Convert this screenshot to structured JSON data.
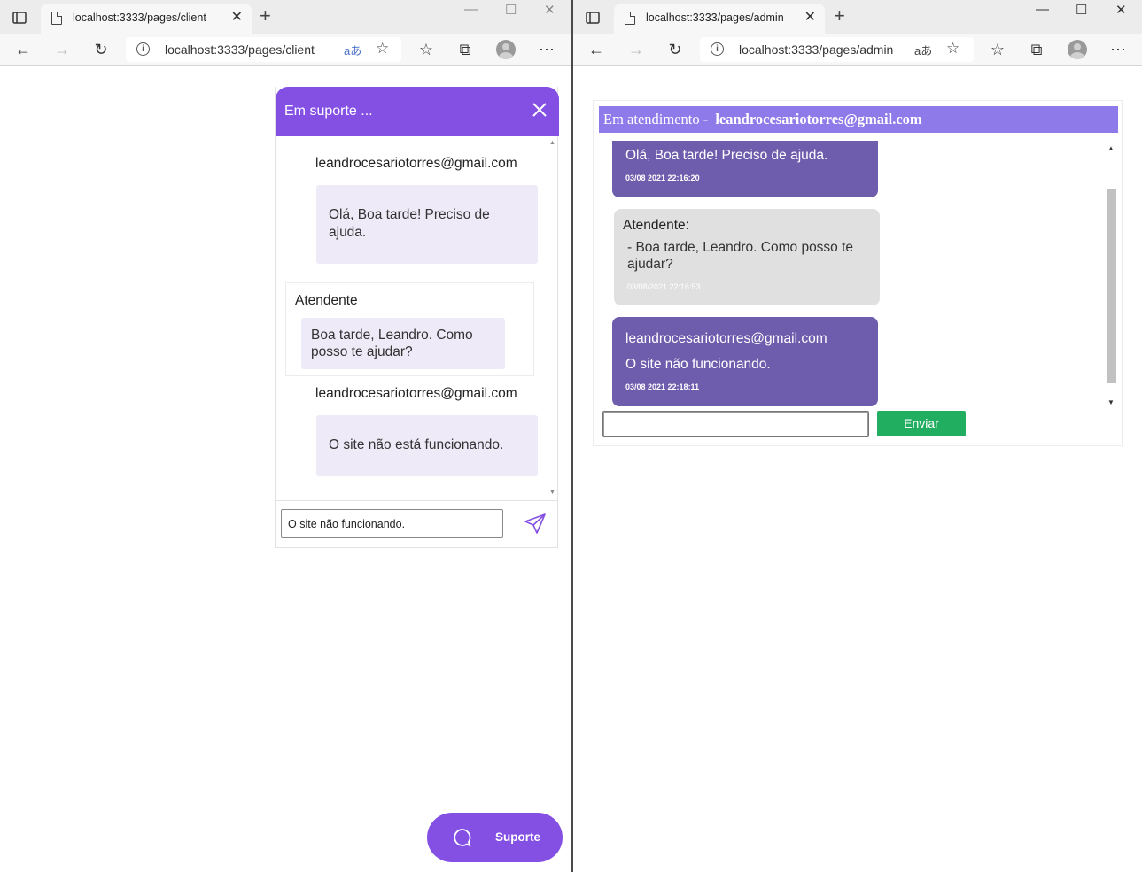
{
  "client_window": {
    "tab_title": "localhost:3333/pages/client",
    "url": "localhost:3333/pages/client",
    "chat": {
      "header_title": "Em suporte ...",
      "messages": [
        {
          "sender": "leandrocesariotorres@gmail.com",
          "text": "Olá, Boa tarde! Preciso de ajuda."
        },
        {
          "sender": "Atendente",
          "text": "Boa tarde, Leandro. Como posso te ajudar?"
        },
        {
          "sender": "leandrocesariotorres@gmail.com",
          "text": "O site não está funcionando."
        }
      ],
      "input_value": "O site não funcionando."
    },
    "support_button_label": "Suporte"
  },
  "admin_window": {
    "tab_title": "localhost:3333/pages/admin",
    "url": "localhost:3333/pages/admin",
    "panel": {
      "header_prefix": "Em atendimento -",
      "header_email": "leandrocesariotorres@gmail.com",
      "messages": [
        {
          "text": "Olá, Boa tarde! Preciso de ajuda.",
          "datetime": "03/08 2021 22:16:20"
        },
        {
          "label": "Atendente:",
          "text": "- Boa tarde, Leandro. Como posso te ajudar?",
          "datetime": "03/08/2021 22:16:53"
        },
        {
          "email": "leandrocesariotorres@gmail.com",
          "text": "O site não funcionando.",
          "datetime": "03/08 2021 22:18:11"
        }
      ],
      "input_value": "",
      "send_label": "Enviar"
    }
  },
  "browser_glyphs": {
    "translate": "aあ",
    "info": "i"
  },
  "colors": {
    "client_accent": "#8450e4",
    "admin_header": "#8e7ae9",
    "admin_bubble": "#6e5dad",
    "send_button": "#22ae60"
  }
}
